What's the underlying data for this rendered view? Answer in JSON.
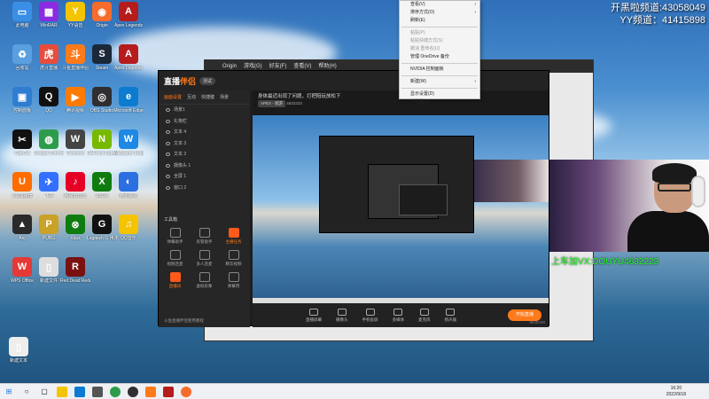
{
  "overlay": {
    "line1": "开黑啦频道:43058049",
    "line2": "YY频道：41415898",
    "cam_caption": "上车加VX:DOUYU4632223"
  },
  "desktop_icons": [
    {
      "label": "此电脑",
      "color": "#3a8ee6",
      "glyph": "▭"
    },
    {
      "label": "WinRAR",
      "color": "#8a2be2",
      "glyph": "▦"
    },
    {
      "label": "YY语音",
      "color": "#f5c400",
      "glyph": "Y"
    },
    {
      "label": "Origin",
      "color": "#f56c2d",
      "glyph": "◉"
    },
    {
      "label": "Apex Legends",
      "color": "#b71c1c",
      "glyph": "A"
    },
    {
      "label": "回收站",
      "color": "#5aa0e0",
      "glyph": "♻"
    },
    {
      "label": "虎牙直播",
      "color": "#e74c3c",
      "glyph": "虎"
    },
    {
      "label": "斗鱼直播伴侣",
      "color": "#ff7a1a",
      "glyph": "斗"
    },
    {
      "label": "Steam",
      "color": "#1b2838",
      "glyph": "S"
    },
    {
      "label": "Apex Legends",
      "color": "#b71c1c",
      "glyph": "A"
    },
    {
      "label": "控制面板",
      "color": "#2e7dd1",
      "glyph": "▣"
    },
    {
      "label": "QQ",
      "color": "#111",
      "glyph": "Q"
    },
    {
      "label": "腾讯视频",
      "color": "#ff7a00",
      "glyph": "▶"
    },
    {
      "label": "OBS Studio",
      "color": "#302e31",
      "glyph": "◎"
    },
    {
      "label": "Microsoft Edge",
      "color": "#0c7bd0",
      "glyph": "e"
    },
    {
      "label": "CapCut",
      "color": "#111",
      "glyph": "✂"
    },
    {
      "label": "Google Chrome",
      "color": "#2c9c4a",
      "glyph": "◍"
    },
    {
      "label": "Overwolf",
      "color": "#444",
      "glyph": "W"
    },
    {
      "label": "GeForce Experience",
      "color": "#76b900",
      "glyph": "N"
    },
    {
      "label": "Wallpaper Engine",
      "color": "#1e88e5",
      "glyph": "W"
    },
    {
      "label": "UU加速器",
      "color": "#ff6d00",
      "glyph": "U"
    },
    {
      "label": "飞书",
      "color": "#3370ff",
      "glyph": "✈"
    },
    {
      "label": "网易云音乐",
      "color": "#e60026",
      "glyph": "♪"
    },
    {
      "label": "XBOX",
      "color": "#107c10",
      "glyph": "X"
    },
    {
      "label": "腾讯会议",
      "color": "#2b6fe0",
      "glyph": "◐"
    },
    {
      "label": "Arc",
      "color": "#2a2a2a",
      "glyph": "▲"
    },
    {
      "label": "PUBG",
      "color": "#c9a227",
      "glyph": "P"
    },
    {
      "label": "Xbox",
      "color": "#107c10",
      "glyph": "⊗"
    },
    {
      "label": "Logitech G HUB",
      "color": "#111",
      "glyph": "G"
    },
    {
      "label": "QQ音乐",
      "color": "#f5c400",
      "glyph": "♫"
    },
    {
      "label": "WPS Office",
      "color": "#e53935",
      "glyph": "W"
    },
    {
      "label": "新建文件",
      "color": "#ddd",
      "glyph": "▯"
    },
    {
      "label": "Red Dead Redemption",
      "color": "#7a1010",
      "glyph": "R"
    },
    {
      "label": "新建文本",
      "color": "#eee",
      "glyph": "▯"
    }
  ],
  "context_menu": [
    {
      "label": "查看(V)",
      "arrow": true,
      "disabled": false
    },
    {
      "label": "排序方式(O)",
      "arrow": true,
      "disabled": false
    },
    {
      "label": "刷新(E)",
      "arrow": false,
      "disabled": false
    },
    {
      "sep": true
    },
    {
      "label": "粘贴(P)",
      "arrow": false,
      "disabled": true
    },
    {
      "label": "粘贴快捷方式(S)",
      "arrow": false,
      "disabled": true
    },
    {
      "label": "撤消 重命名(U)",
      "arrow": false,
      "disabled": true
    },
    {
      "label": "管理 OneDrive 备份",
      "arrow": false,
      "disabled": false
    },
    {
      "sep": true
    },
    {
      "label": "NVIDIA 控制面板",
      "arrow": false,
      "disabled": false
    },
    {
      "sep": true
    },
    {
      "label": "新建(W)",
      "arrow": true,
      "disabled": false
    },
    {
      "sep": true
    },
    {
      "label": "显示设置(D)",
      "arrow": false,
      "disabled": false
    },
    {
      "label": "个性化(R)",
      "arrow": false,
      "disabled": false
    }
  ],
  "origin": {
    "title": "Origin",
    "menu": [
      "Origin",
      "游戏(G)",
      "好友(F)",
      "查看(V)",
      "帮助(H)"
    ]
  },
  "zb": {
    "logo_a": "直播",
    "logo_b": "伴侣",
    "version": "测试",
    "tabs": [
      "画面设置",
      "互动",
      "快捷键",
      "场景"
    ],
    "sources": [
      "场景1",
      "礼物栏",
      "文本 4",
      "文本 3",
      "文本 2",
      "摄像头 1",
      "全屏 1",
      "窗口 2"
    ],
    "tools_title": "工具箱",
    "tools": [
      {
        "label": "弹幕助手",
        "hot": false
      },
      {
        "label": "房管助手",
        "hot": false
      },
      {
        "label": "主播任务",
        "hot": true
      },
      {
        "label": "视频连麦",
        "hot": false
      },
      {
        "label": "多人连麦",
        "hot": false
      },
      {
        "label": "精华视频",
        "hot": false
      },
      {
        "label": "直播间",
        "hot": true
      },
      {
        "label": "虚拟形象",
        "hot": false
      },
      {
        "label": "弹幕用",
        "hot": false
      }
    ],
    "footer": "斗鱼直播伴侣使用教程",
    "stream_title": "身体最近出现了问题，打把陪玩放松下",
    "category": "APEX - 端游",
    "room_id": "4632223",
    "controls": [
      "直播屏幕",
      "摄像头",
      "手机投屏",
      "多媒体",
      "麦克风",
      "扬声器"
    ],
    "start": "开始直播",
    "time": "00:00:00"
  },
  "taskbar": {
    "time": "16:20",
    "date": "2022/9/18"
  }
}
